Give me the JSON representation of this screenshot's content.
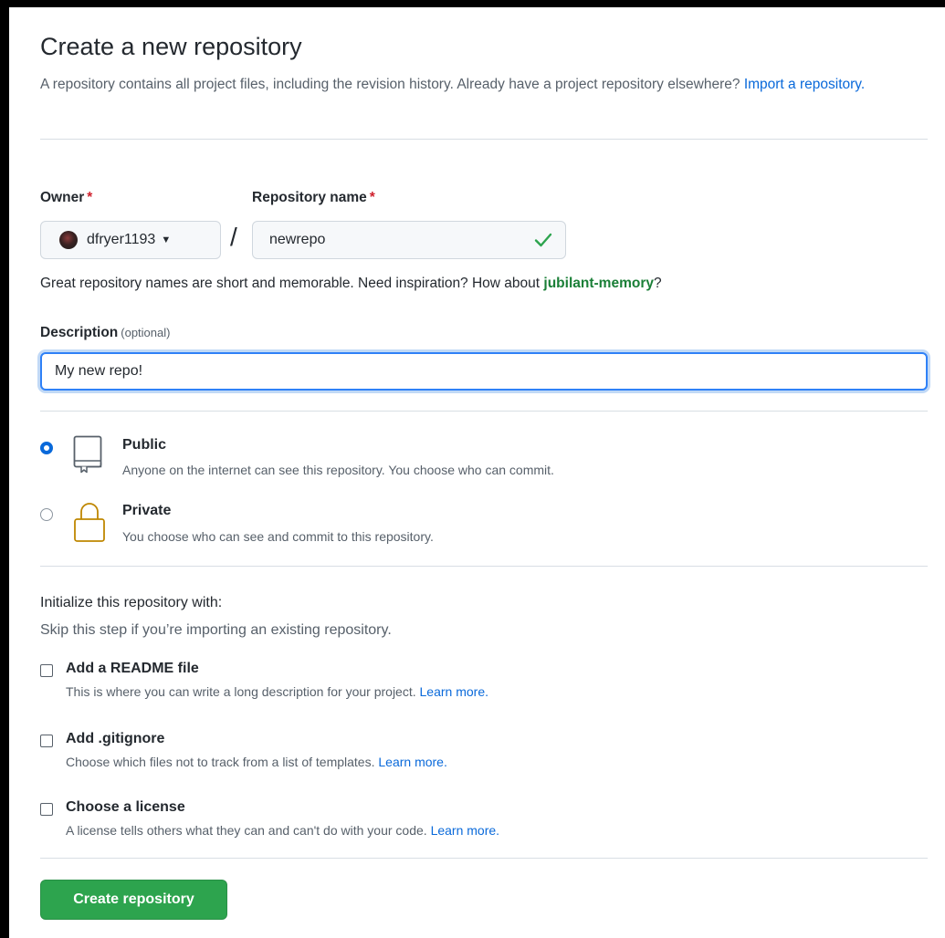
{
  "header": {
    "title": "Create a new repository",
    "subtitle": "A repository contains all project files, including the revision history. Already have a project repository elsewhere?",
    "import_link": "Import a repository."
  },
  "owner": {
    "label": "Owner",
    "required_mark": "*",
    "value": "dfryer1193"
  },
  "separator": "/",
  "repo_name": {
    "label": "Repository name",
    "required_mark": "*",
    "value": "newrepo",
    "valid": true
  },
  "hint": {
    "text": "Great repository names are short and memorable. Need inspiration? How about",
    "suggestion": "jubilant-memory",
    "suffix": "?"
  },
  "description": {
    "label": "Description",
    "optional": "(optional)",
    "value": "My new repo!"
  },
  "visibility": {
    "selected": "public",
    "options": [
      {
        "id": "public",
        "title": "Public",
        "desc": "Anyone on the internet can see this repository. You choose who can commit."
      },
      {
        "id": "private",
        "title": "Private",
        "desc": "You choose who can see and commit to this repository."
      }
    ]
  },
  "init": {
    "title": "Initialize this repository with:",
    "subtitle": "Skip this step if you’re importing an existing repository.",
    "options": [
      {
        "title": "Add a README file",
        "desc": "This is where you can write a long description for your project.",
        "link": "Learn more.",
        "checked": false
      },
      {
        "title": "Add .gitignore",
        "desc": "Choose which files not to track from a list of templates.",
        "link": "Learn more.",
        "checked": false
      },
      {
        "title": "Choose a license",
        "desc": "A license tells others what they can and can't do with your code.",
        "link": "Learn more.",
        "checked": false
      }
    ]
  },
  "submit": {
    "label": "Create repository"
  },
  "colors": {
    "accent_blue": "#0969da",
    "success_green": "#1a7f37",
    "button_green": "#2da44e",
    "required_red": "#cf222e"
  }
}
